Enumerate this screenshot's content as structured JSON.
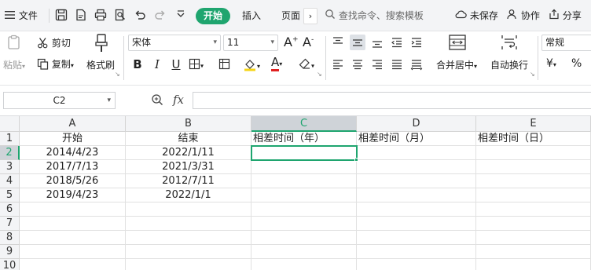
{
  "menubar": {
    "file_label": "文件",
    "tabs": [
      "开始",
      "插入",
      "页面"
    ],
    "search_placeholder": "查找命令、搜索模板",
    "unsaved_label": "未保存",
    "collab_label": "协作",
    "share_label": "分享"
  },
  "ribbon": {
    "paste_label": "粘贴",
    "cut_label": "剪切",
    "copy_label": "复制",
    "format_painter_label": "格式刷",
    "font_name": "宋体",
    "font_size": "11",
    "merge_center_label": "合并居中",
    "wrap_text_label": "自动换行",
    "number_format": "常规",
    "currency_symbol": "¥",
    "percent_symbol": "%",
    "bold": "B",
    "italic": "I",
    "underline": "U",
    "font_color_letter": "A",
    "accent_color": "#1fa56f",
    "font_color": "#e02020",
    "fill_color": "#f5d416"
  },
  "formula_bar": {
    "cell_ref": "C2",
    "fx_label": "fx",
    "formula": ""
  },
  "sheet": {
    "columns": [
      "A",
      "B",
      "C",
      "D",
      "E"
    ],
    "active_column": "C",
    "rows": [
      "1",
      "2",
      "3",
      "4",
      "5",
      "6",
      "7",
      "8",
      "9",
      "10"
    ],
    "active_row": "2",
    "cells": {
      "A1": "开始",
      "B1": "结束",
      "C1": "相差时间（年）",
      "D1": "相差时间（月）",
      "E1": "相差时间（日）",
      "A2": "2014/4/23",
      "B2": "2022/1/11",
      "A3": "2017/7/13",
      "B3": "2021/3/31",
      "A4": "2018/5/26",
      "B4": "2012/7/11",
      "A5": "2019/4/23",
      "B5": "2022/1/1"
    }
  }
}
